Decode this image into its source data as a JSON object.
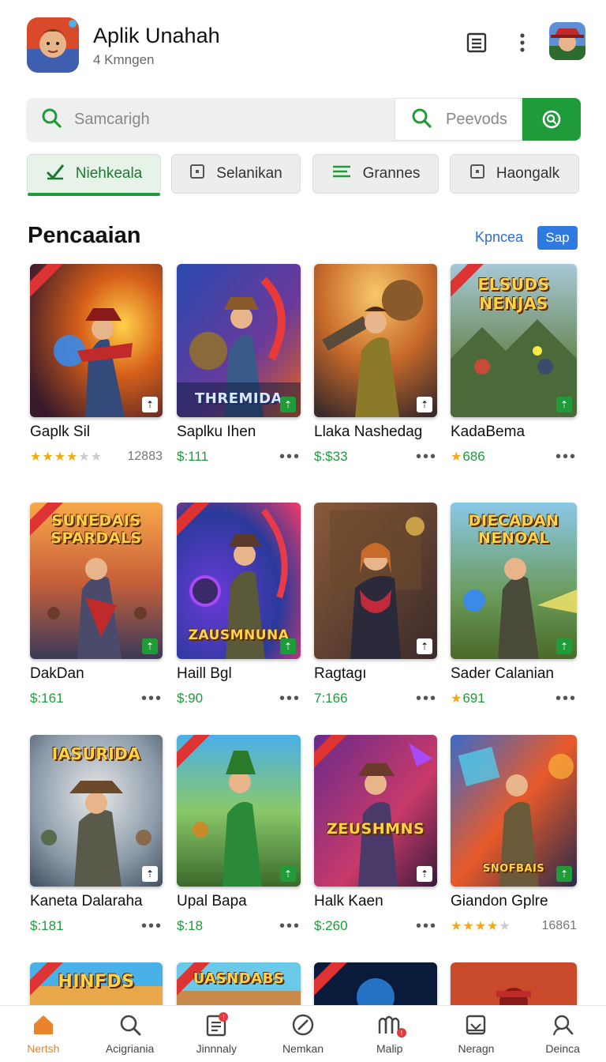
{
  "header": {
    "title": "Aplik Unahah",
    "subtitle": "4 Kmngen",
    "icons": [
      "list-icon",
      "more-vertical-icon"
    ]
  },
  "search": {
    "placeholder": "Samcarigh",
    "secondary_placeholder": "Peevods"
  },
  "tabs": [
    {
      "label": "Niehkeala",
      "icon": "check-icon",
      "active": true
    },
    {
      "label": "Selanikan",
      "icon": "square-icon",
      "active": false
    },
    {
      "label": "Grannes",
      "icon": "lines-icon",
      "active": false
    },
    {
      "label": "Haongalk",
      "icon": "square-icon",
      "active": false
    }
  ],
  "section": {
    "title": "Pencaaian",
    "link": "Kpncea",
    "pill": "Sap"
  },
  "games": [
    {
      "name": "Gaplk Sil",
      "rating": 4,
      "count": "12883",
      "price": "",
      "more": false
    },
    {
      "name": "Saplku Ihen",
      "price": "$:111",
      "more": true,
      "art_text": "THREMIDA"
    },
    {
      "name": "Llaka Nashedag",
      "price": "$:$33",
      "more": true
    },
    {
      "name": "KadaBema",
      "star_price": "686",
      "more": true,
      "art_text": "ELSUDS NENJAS"
    },
    {
      "name": "DakDan",
      "price": "$:161",
      "more": true,
      "art_text": "SUNEDAIS SPARDALS"
    },
    {
      "name": "Haill Bgl",
      "price": "$:90",
      "more": true,
      "art_text": "ZAUSMNUNA"
    },
    {
      "name": "Ragtagı",
      "price": "7:166",
      "more": true
    },
    {
      "name": "Sader Calanian",
      "star_price": "691",
      "more": true,
      "art_text": "DIECADAN NENOAL"
    },
    {
      "name": "Kaneta Dalaraha",
      "price": "$:181",
      "more": true,
      "art_text": "IASURIDA"
    },
    {
      "name": "Upal Bapa",
      "price": "$:18",
      "more": true
    },
    {
      "name": "Halk Kaen",
      "price": "$:260",
      "more": true,
      "art_text": "ZEUSHMNS"
    },
    {
      "name": "Giandon Gplre",
      "rating": 4,
      "count": "16861",
      "more": false,
      "art_text": "SNOFBAIS"
    },
    {
      "name": "",
      "art_text": "HINFDS"
    },
    {
      "name": "",
      "art_text": "UASNDABS"
    },
    {
      "name": ""
    },
    {
      "name": ""
    }
  ],
  "nav": [
    {
      "label": "Nertsh",
      "icon": "home-icon",
      "active": true
    },
    {
      "label": "Acigriania",
      "icon": "search-icon",
      "active": false
    },
    {
      "label": "Jinnnaly",
      "icon": "document-icon",
      "active": false,
      "badge": true
    },
    {
      "label": "Nemkan",
      "icon": "compass-icon",
      "active": false
    },
    {
      "label": "Malip",
      "icon": "book-icon",
      "active": false,
      "badge": true
    },
    {
      "label": "Neragn",
      "icon": "inbox-icon",
      "active": false
    },
    {
      "label": "Deinca",
      "icon": "user-search-icon",
      "active": false
    }
  ],
  "colors": {
    "accent": "#1f9b3a",
    "link": "#2a6fcf",
    "nav_active": "#e8852b"
  }
}
